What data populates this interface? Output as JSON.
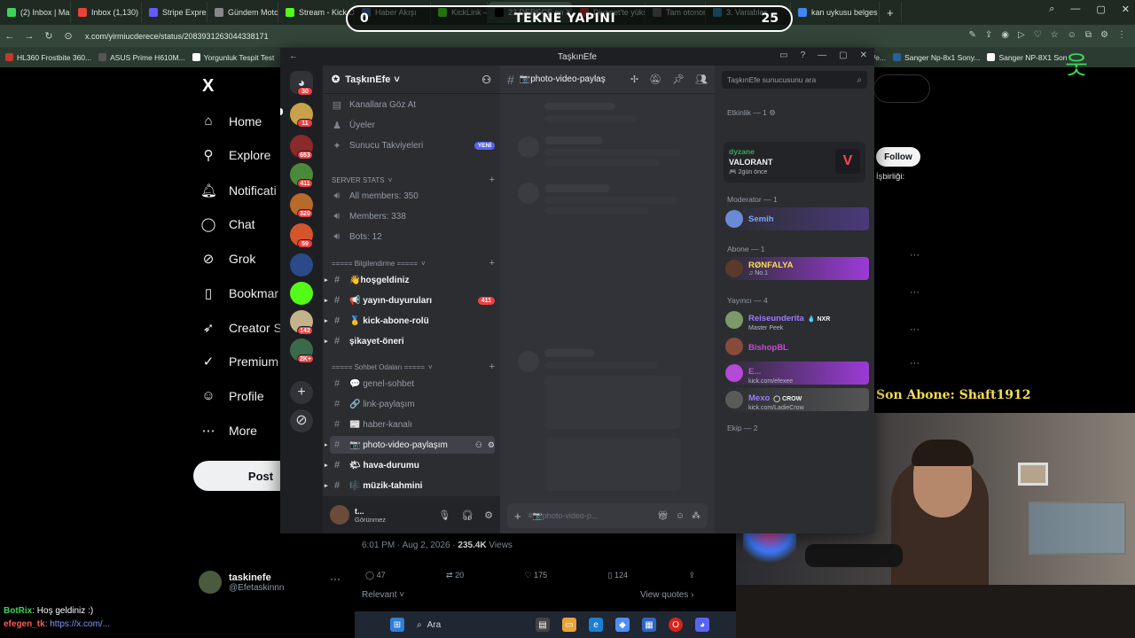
{
  "browser": {
    "tabs": [
      {
        "label": "(2) Inbox | Mail | SC",
        "color": "#3cd35c",
        "active": false
      },
      {
        "label": "Inbox (1,130) - kick",
        "color": "#ea4335",
        "active": false
      },
      {
        "label": "Stripe Express",
        "color": "#635bff",
        "active": false
      },
      {
        "label": "Gündem Motoru",
        "color": "#888888",
        "active": false
      },
      {
        "label": "Stream - Kick Dash",
        "color": "#53fc18",
        "active": false
      },
      {
        "label": "Haber Akışı",
        "color": "#4a6fa5",
        "active": false
      },
      {
        "label": "KickLink — Chat Li",
        "color": "#53fc18",
        "active": false
      },
      {
        "label": "23 DERECE on X: \"Düğün",
        "color": "#000000",
        "active": true
      },
      {
        "label": "Diyanet'te yüksek",
        "color": "#c0392b",
        "active": false
      },
      {
        "label": "Tam otonom sürüş",
        "color": "#666666",
        "active": false
      },
      {
        "label": "3. Variables",
        "color": "#2c8ebb",
        "active": false
      },
      {
        "label": "kan uykusu belges",
        "color": "#4285f4",
        "active": false
      }
    ],
    "new_tab": "+",
    "url": "x.com/yirmiucderece/status/2083931263044338171",
    "bookmarks": [
      {
        "label": "HL360 Frostbite 360...",
        "color": "#c0392b"
      },
      {
        "label": "ASUS Prime H610M...",
        "color": "#555555"
      },
      {
        "label": "Yorgunluk Tespit Test",
        "color": "#ffffff"
      },
      {
        "label": "al We...",
        "color": "#888888"
      },
      {
        "label": "Sanger Np-8x1 Sony...",
        "color": "#2c5f9e"
      },
      {
        "label": "Sanger NP-8X1 Son",
        "color": "#ffffff"
      }
    ]
  },
  "scoreboard": {
    "left": "0",
    "title": "TEKNE YAPINI",
    "right": "25"
  },
  "x_sidebar": {
    "logo": "X",
    "nav": [
      {
        "label": "Home",
        "icon": "home-icon",
        "glyph": "⌂"
      },
      {
        "label": "Explore",
        "icon": "search-icon",
        "glyph": "⚲"
      },
      {
        "label": "Notificati",
        "icon": "bell-icon",
        "glyph": "🔔︎"
      },
      {
        "label": "Chat",
        "icon": "chat-icon",
        "glyph": "◯"
      },
      {
        "label": "Grok",
        "icon": "grok-icon",
        "glyph": "⊘"
      },
      {
        "label": "Bookmar",
        "icon": "bookmark-icon",
        "glyph": "▯"
      },
      {
        "label": "Creator S",
        "icon": "rocket-icon",
        "glyph": "➶"
      },
      {
        "label": "Premium",
        "icon": "verified-icon",
        "glyph": "✓"
      },
      {
        "label": "Profile",
        "icon": "person-icon",
        "glyph": "☺"
      },
      {
        "label": "More",
        "icon": "more-icon",
        "glyph": "⋯"
      }
    ],
    "post_label": "Post",
    "account": {
      "name": "taskinefe",
      "handle": "@Efetaskinnn",
      "more": "···"
    }
  },
  "tweet": {
    "time": "6:01 PM · Aug 2, 2026 · ",
    "views_count": "235.4K",
    "views_label": " Views",
    "replies": "47",
    "reposts": "20",
    "likes": "175",
    "bookmarks": "124",
    "relevant": "Relevant",
    "view_quotes": "View quotes"
  },
  "x_right": {
    "follow": "Follow",
    "isbirligi": "İşbirliği:"
  },
  "overlay": {
    "son_abone": "Son Abone: Shaft1912",
    "chat_user": "BotRix",
    "chat_msg": ": Hoş geldiniz :)",
    "chat2_user": "efegen_tk",
    "chat2_msg": ": https://x.com/..."
  },
  "taskbar": {
    "search": "Ara"
  },
  "discord": {
    "window_title": "TaşkınEfe",
    "guild_badges": [
      "30",
      "11",
      "653",
      "411",
      "320",
      "59",
      "142",
      "2K+"
    ],
    "server_name": "TaşkınEfe",
    "top_items": [
      {
        "label": "Kanallara Göz At",
        "icon": "browse-icon"
      },
      {
        "label": "Üyeler",
        "icon": "members-icon"
      },
      {
        "label": "Sunucu Takviyeleri",
        "icon": "boost-icon",
        "tag": "YENİ"
      }
    ],
    "cat_stats": "SERVER STATS",
    "stats": [
      "All members: 350",
      "Members: 338",
      "Bots: 12"
    ],
    "cat_info": "===== Bilgilendirme =====",
    "info_channels": [
      {
        "label": "👋hoşgeldiniz",
        "badge": ""
      },
      {
        "label": "📢 yayın-duyuruları",
        "badge": "411"
      },
      {
        "label": "🥇 kick-abone-rolü",
        "badge": ""
      },
      {
        "label": "şikayet-öneri",
        "badge": ""
      }
    ],
    "cat_chat": "===== Sohbet Odaları =====",
    "chat_channels": [
      {
        "label": "💬 genel-sohbet",
        "state": "read"
      },
      {
        "label": "🔗 link-paylaşım",
        "state": "read"
      },
      {
        "label": "📰 haber-kanalı",
        "state": "read"
      },
      {
        "label": "📷 photo-video-paylaşım",
        "state": "selected"
      },
      {
        "label": "🌤 hava-durumu",
        "state": "unread"
      },
      {
        "label": "🎼 müzik-tahmini",
        "state": "unread"
      }
    ],
    "user": {
      "name": "t...",
      "status": "Görünmez"
    },
    "chat_header": "📷photo-video-paylaş",
    "input_placeholder": "#📷photo-video-p...",
    "member_search": "TaşkınEfe sunucusunu ara",
    "members": {
      "etkinlik_header": "Etkinlik — 1 ⚙",
      "activity": {
        "name": "dyzane",
        "game": "VALORANT",
        "time": "🎮 2gün önce"
      },
      "moderator_header": "Moderator — 1",
      "moderator": {
        "name": "Semih"
      },
      "abone_header": "Abone — 1",
      "abone": {
        "name": "RØNFALYA",
        "sub": "♫ No.1"
      },
      "yayinci_header": "Yayıncı — 4",
      "yayincilar": [
        {
          "name": "Reiseunderita",
          "tag": "💧 NXR",
          "sub": "Master Peek"
        },
        {
          "name": "BishopBL",
          "tag": "",
          "sub": ""
        },
        {
          "name": "E...",
          "tag": "",
          "sub": "kick.com/efexee"
        },
        {
          "name": "Mexo",
          "tag": "◯ CROW",
          "sub": "kick.com/LadieCrow"
        }
      ],
      "ekip_header": "Ekip — 2"
    }
  }
}
